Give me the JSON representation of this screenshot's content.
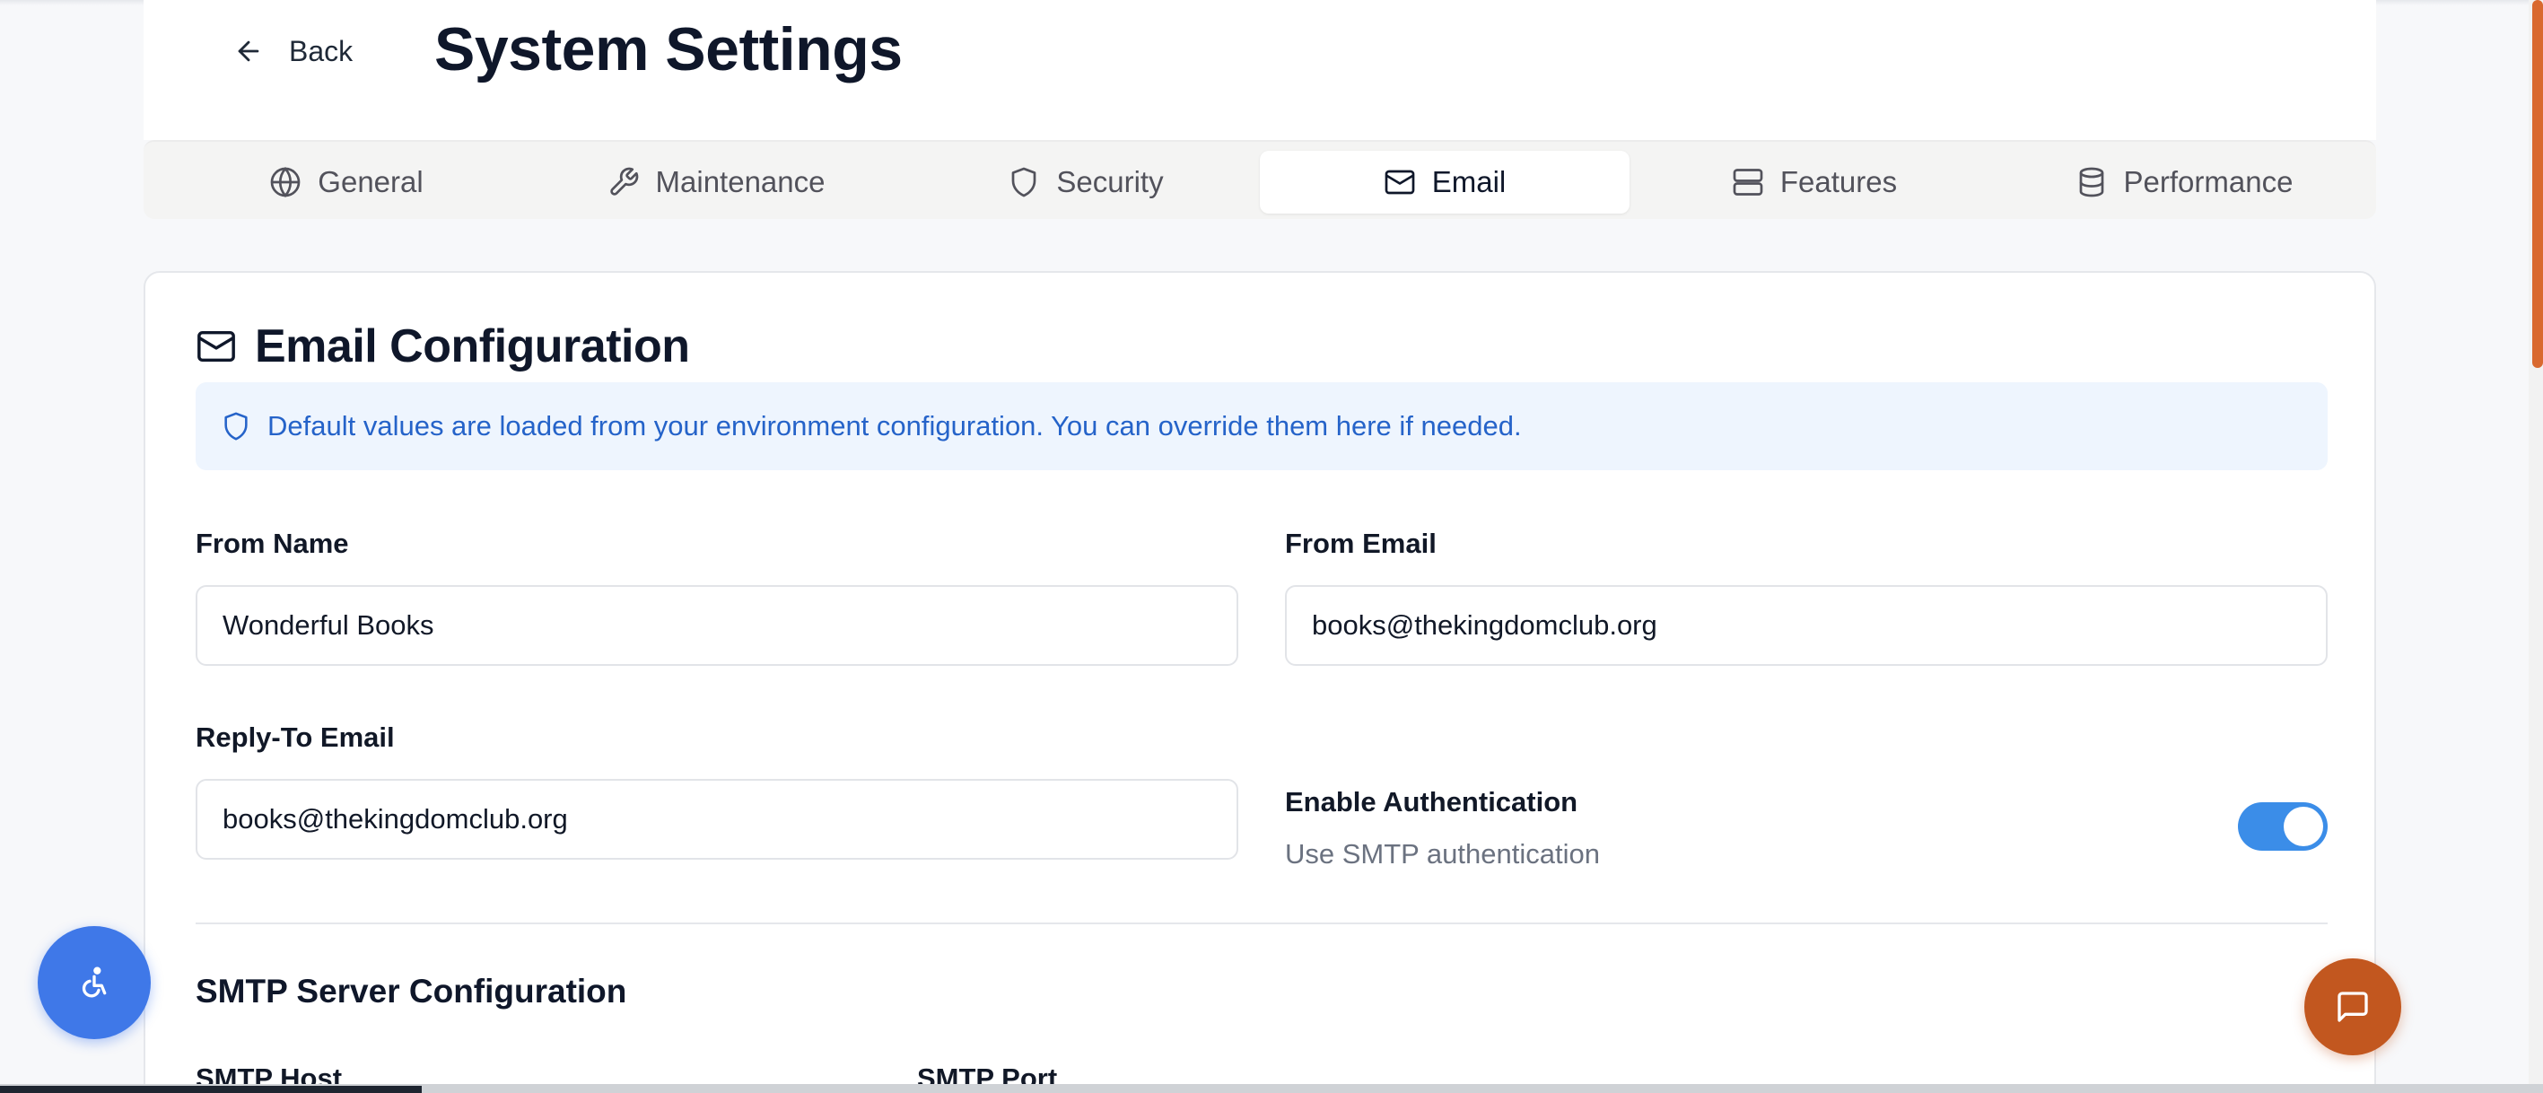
{
  "header": {
    "back_label": "Back",
    "title": "System Settings"
  },
  "tabs": [
    {
      "label": "General",
      "icon": "globe-icon",
      "active": false
    },
    {
      "label": "Maintenance",
      "icon": "wrench-icon",
      "active": false
    },
    {
      "label": "Security",
      "icon": "shield-icon",
      "active": false
    },
    {
      "label": "Email",
      "icon": "mail-icon",
      "active": true
    },
    {
      "label": "Features",
      "icon": "server-icon",
      "active": false
    },
    {
      "label": "Performance",
      "icon": "database-icon",
      "active": false
    }
  ],
  "card": {
    "title": "Email Configuration",
    "notice": "Default values are loaded from your environment configuration. You can override them here if needed.",
    "from_name": {
      "label": "From Name",
      "value": "Wonderful Books"
    },
    "from_email": {
      "label": "From Email",
      "value": "books@thekingdomclub.org"
    },
    "reply_to": {
      "label": "Reply-To Email",
      "value": "books@thekingdomclub.org"
    },
    "auth": {
      "label": "Enable Authentication",
      "description": "Use SMTP authentication",
      "enabled": true
    },
    "smtp": {
      "section_title": "SMTP Server Configuration",
      "host_label": "SMTP Host",
      "port_label": "SMTP Port"
    }
  },
  "colors": {
    "accent_blue": "#3b8de8",
    "notice_text": "#2563c9",
    "chat_orange": "#c2571f"
  }
}
